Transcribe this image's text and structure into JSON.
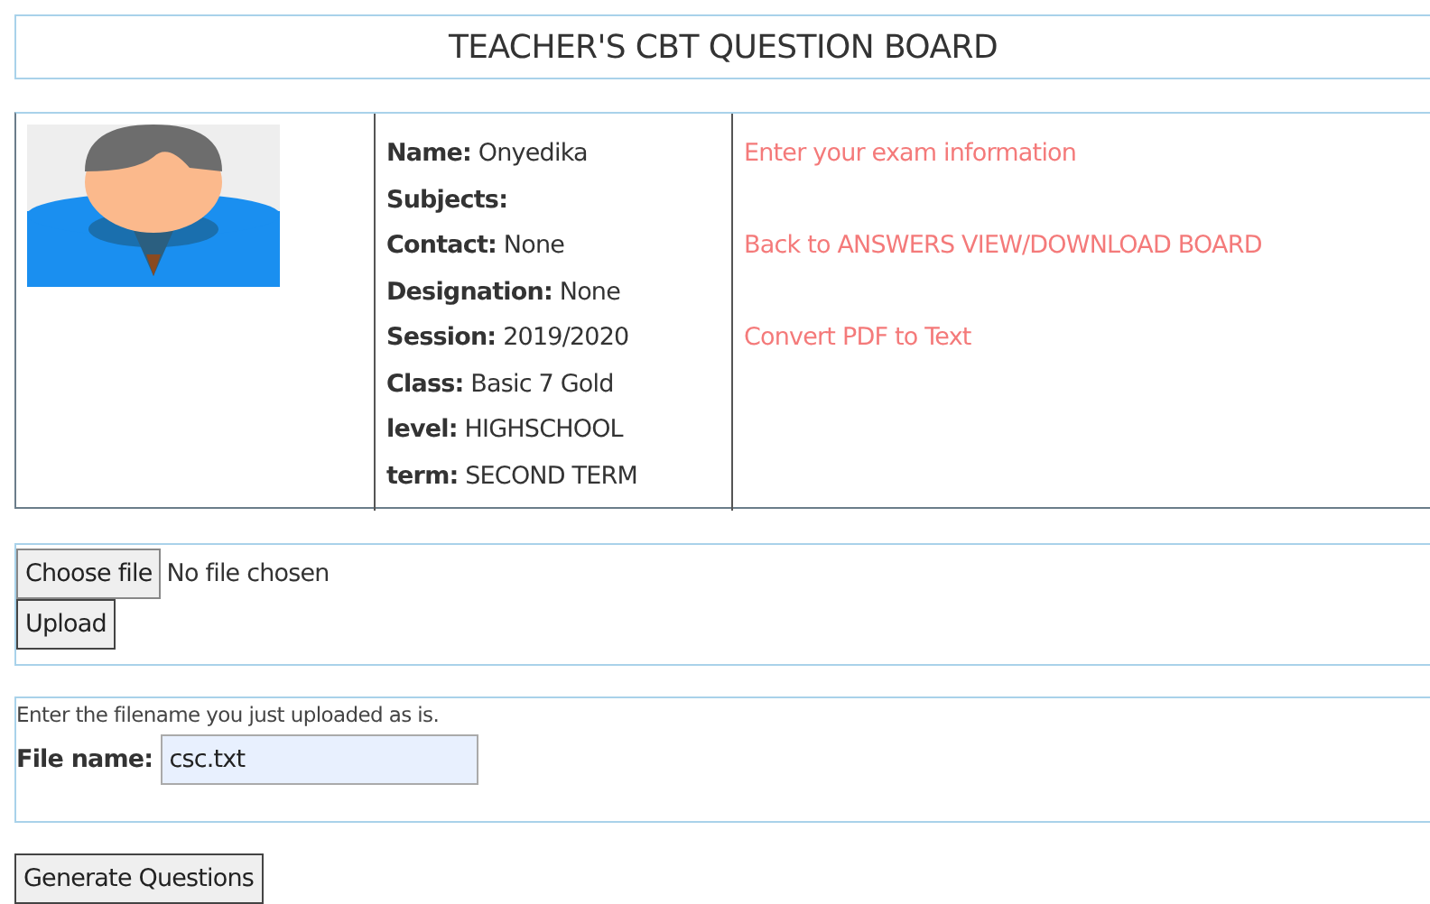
{
  "header": {
    "title": "TEACHER'S CBT QUESTION BOARD"
  },
  "profile": {
    "fields": [
      {
        "label": "Name:",
        "value": "Onyedika"
      },
      {
        "label": "Subjects:"
      },
      {
        "label": "Contact:",
        "value": "None"
      },
      {
        "label": "Designation:",
        "value": "None"
      },
      {
        "label": "Session:",
        "value": "2019/2020"
      },
      {
        "label": "Class:",
        "value": "Basic 7 Gold"
      },
      {
        "label": "level:",
        "value": "HIGHSCHOOL"
      },
      {
        "label": "term:",
        "value": "SECOND TERM"
      }
    ],
    "links": [
      {
        "label": "Enter your exam information"
      },
      {
        "label": "Back to ANSWERS VIEW/DOWNLOAD BOARD"
      },
      {
        "label": "Convert PDF to Text"
      }
    ]
  },
  "upload": {
    "choose_button": "Choose file",
    "file_status": "No file chosen",
    "upload_button": "Upload"
  },
  "filename_form": {
    "hint": "Enter the filename you just uploaded as is.",
    "label": "File name:",
    "value": "csc.txt"
  },
  "generate_button": "Generate Questions"
}
